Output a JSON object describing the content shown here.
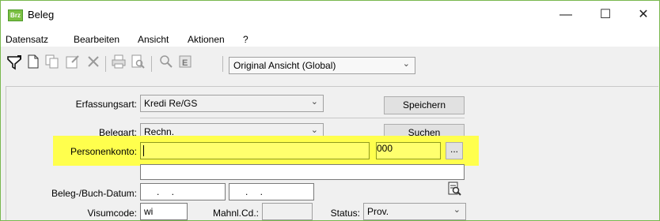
{
  "window": {
    "title": "Beleg",
    "icon": "brz-app-icon",
    "icon_text": "Brz",
    "minimize": "—",
    "maximize": "☐",
    "close": "✕"
  },
  "menu": {
    "items": [
      "Datensatz",
      "Bearbeiten",
      "Ansicht",
      "Aktionen",
      "?"
    ]
  },
  "toolbar": {
    "icons": [
      "filter-icon",
      "new-icon",
      "copy-icon",
      "properties-icon",
      "delete-icon",
      "print-icon",
      "print-preview-icon",
      "search-icon",
      "export-icon"
    ],
    "view_select": "Original Ansicht (Global)"
  },
  "form": {
    "erfassungsart": {
      "label": "Erfassungsart:",
      "value": "Kredi Re/GS"
    },
    "speichern_label": "Speichern",
    "belegart": {
      "label": "Belegart:",
      "value": "Rechn."
    },
    "suchen_label": "Suchen",
    "personenkonto": {
      "label": "Personenkonto:",
      "value": "",
      "number": "000",
      "browse": "..."
    },
    "datum": {
      "label": "Beleg-/Buch-Datum:",
      "value1": ".  .",
      "value2": ".  ."
    },
    "visumcode": {
      "label": "Visumcode:",
      "value": "wi"
    },
    "mahnl": {
      "label": "Mahnl.Cd.:",
      "value": ""
    },
    "status": {
      "label": "Status:",
      "value": "Prov."
    }
  },
  "colors": {
    "highlight": "#ffff4d",
    "window_border": "#79b84f",
    "app_icon": "#7bc043"
  }
}
